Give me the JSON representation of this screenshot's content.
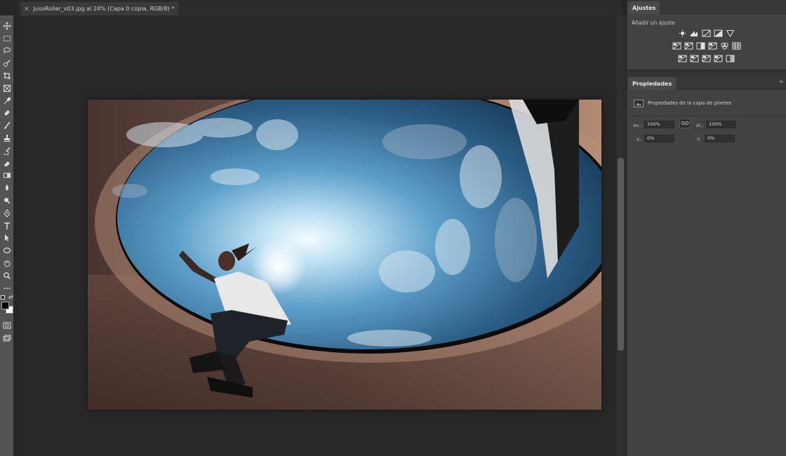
{
  "document": {
    "close_glyph": "×",
    "tab_title": "JusoRoller_v03.jpg al 24% (Capa 0 copia, RGB/8) *"
  },
  "tools": [
    "move-tool-icon",
    "marquee-tool-icon",
    "lasso-tool-icon",
    "quick-selection-icon",
    "crop-tool-icon",
    "frame-tool-icon",
    "eyedropper-icon",
    "healing-brush-icon",
    "brush-tool-icon",
    "clone-stamp-icon",
    "history-brush-icon",
    "eraser-icon",
    "gradient-tool-icon",
    "blur-tool-icon",
    "dodge-tool-icon",
    "pen-tool-icon",
    "type-tool-icon",
    "path-selection-icon",
    "shape-tool-icon",
    "hand-tool-icon",
    "zoom-tool-icon",
    "more-tools-icon"
  ],
  "colors": {
    "foreground": "#000000",
    "background": "#ffffff",
    "workspace": "#282828",
    "panel": "#424242",
    "toolbar": "#535353"
  },
  "adjustments": {
    "tab_label": "Ajustes",
    "add_label": "Añadir un ajuste",
    "rows": [
      [
        "brightness-contrast-icon",
        "levels-icon",
        "curves-icon",
        "exposure-icon",
        "vibrance-icon"
      ],
      [
        "hue-saturation-icon",
        "color-balance-icon",
        "black-white-icon",
        "photo-filter-icon",
        "channel-mixer-icon",
        "color-lookup-icon"
      ],
      [
        "invert-icon",
        "posterize-icon",
        "threshold-icon",
        "selective-color-icon",
        "gradient-map-icon"
      ]
    ]
  },
  "properties": {
    "tab_label": "Propiedades",
    "menu_glyph": "»",
    "layer_type": "Propiedades de la capa de píxeles",
    "width_label": "An.:",
    "width_value": "100%",
    "link_label": "GO",
    "height_label": "Al.:",
    "height_value": "100%",
    "x_label": "X:",
    "x_value": "0%",
    "y_label": "Y:",
    "y_value": "0%"
  }
}
